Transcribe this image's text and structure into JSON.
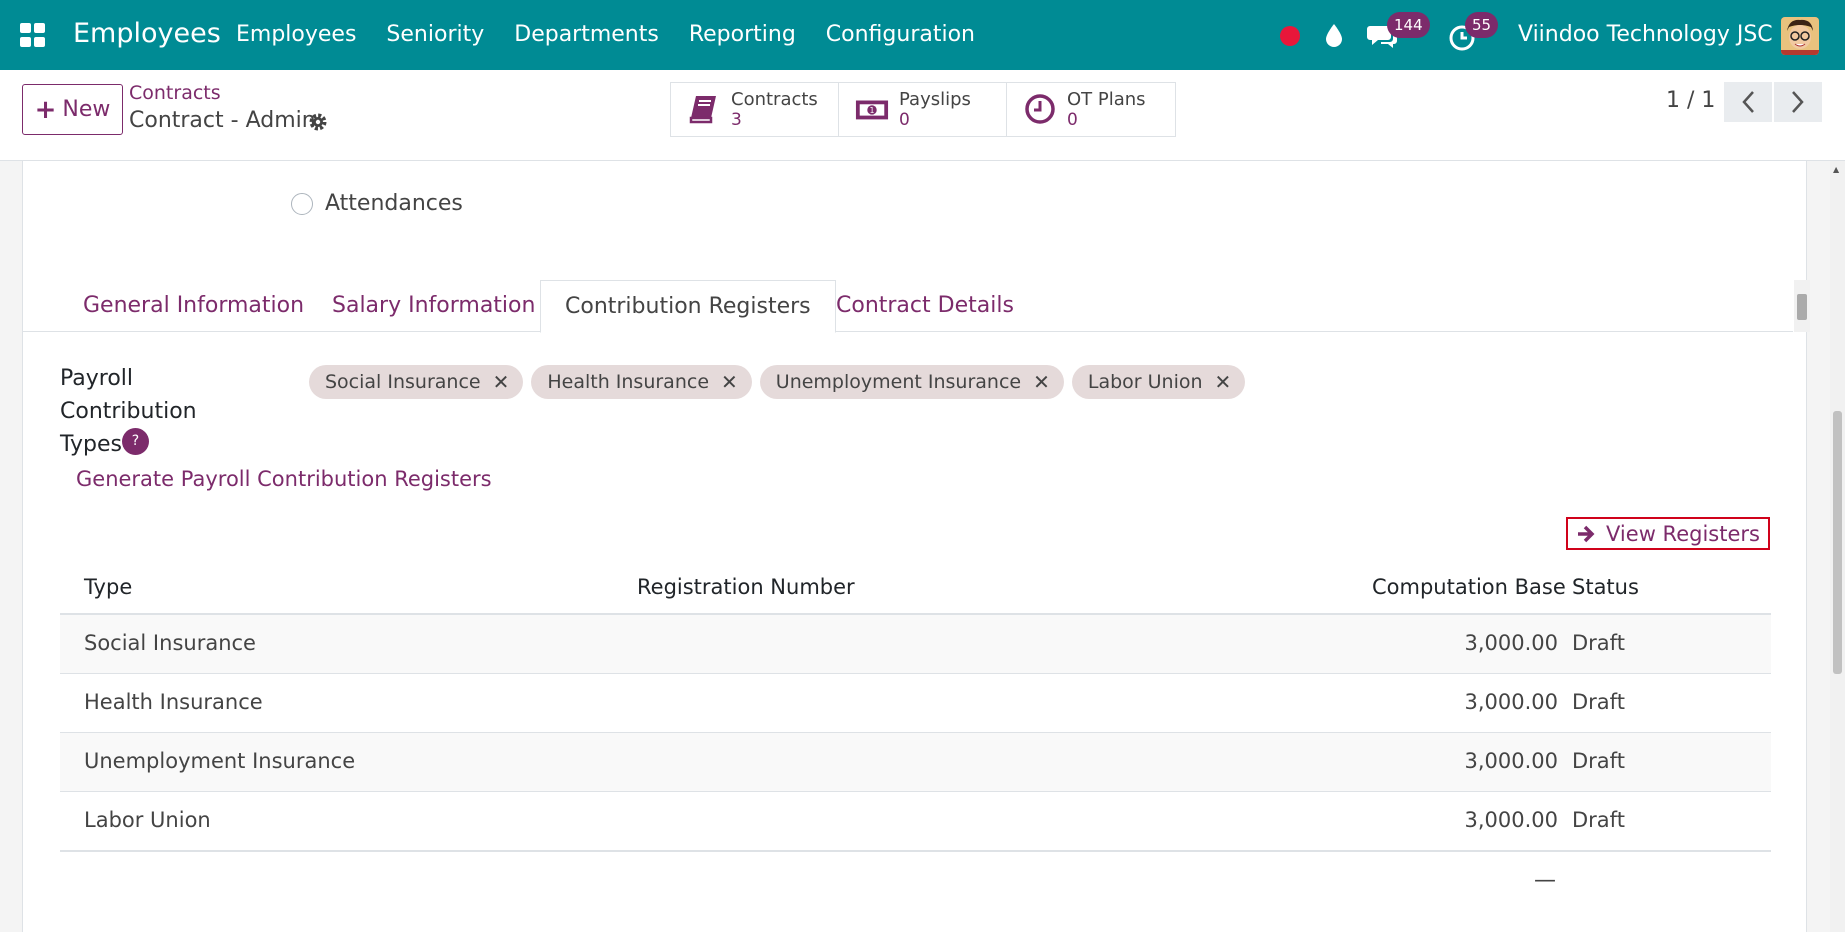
{
  "topbar": {
    "app_title": "Employees",
    "menu": [
      "Employees",
      "Seniority",
      "Departments",
      "Reporting",
      "Configuration"
    ],
    "messages_count": "144",
    "activities_count": "55",
    "company": "Viindoo Technology JSC"
  },
  "control_panel": {
    "new_label": "New",
    "breadcrumb_parent": "Contracts",
    "breadcrumb_current": "Contract - Admin",
    "stats": [
      {
        "label": "Contracts",
        "value": "3"
      },
      {
        "label": "Payslips",
        "value": "0"
      },
      {
        "label": "OT Plans",
        "value": "0"
      }
    ],
    "pager": "1 / 1"
  },
  "form": {
    "attendances_label": "Attendances",
    "tabs": [
      "General Information",
      "Salary Information",
      "Contribution Registers",
      "Contract Details"
    ],
    "active_tab": "Contribution Registers",
    "contribution_types_label_line1": "Payroll Contribution",
    "contribution_types_label_line2": "Types",
    "help_mark": "?",
    "contribution_tags": [
      "Social Insurance",
      "Health Insurance",
      "Unemployment Insurance",
      "Labor Union"
    ],
    "generate_link": "Generate Payroll Contribution Registers",
    "view_registers_label": "View Registers"
  },
  "registers_table": {
    "headers": [
      "Type",
      "Registration Number",
      "Computation Base",
      "Status"
    ],
    "rows": [
      {
        "type": "Social Insurance",
        "registration_number": "",
        "computation_base": "3,000.00",
        "status": "Draft"
      },
      {
        "type": "Health Insurance",
        "registration_number": "",
        "computation_base": "3,000.00",
        "status": "Draft"
      },
      {
        "type": "Unemployment Insurance",
        "registration_number": "",
        "computation_base": "3,000.00",
        "status": "Draft"
      },
      {
        "type": "Labor Union",
        "registration_number": "",
        "computation_base": "3,000.00",
        "status": "Draft"
      }
    ],
    "footer_total": "—"
  },
  "colors": {
    "navbar": "#008b94",
    "accent": "#7c2b6b",
    "highlight_border": "#d0021b"
  }
}
